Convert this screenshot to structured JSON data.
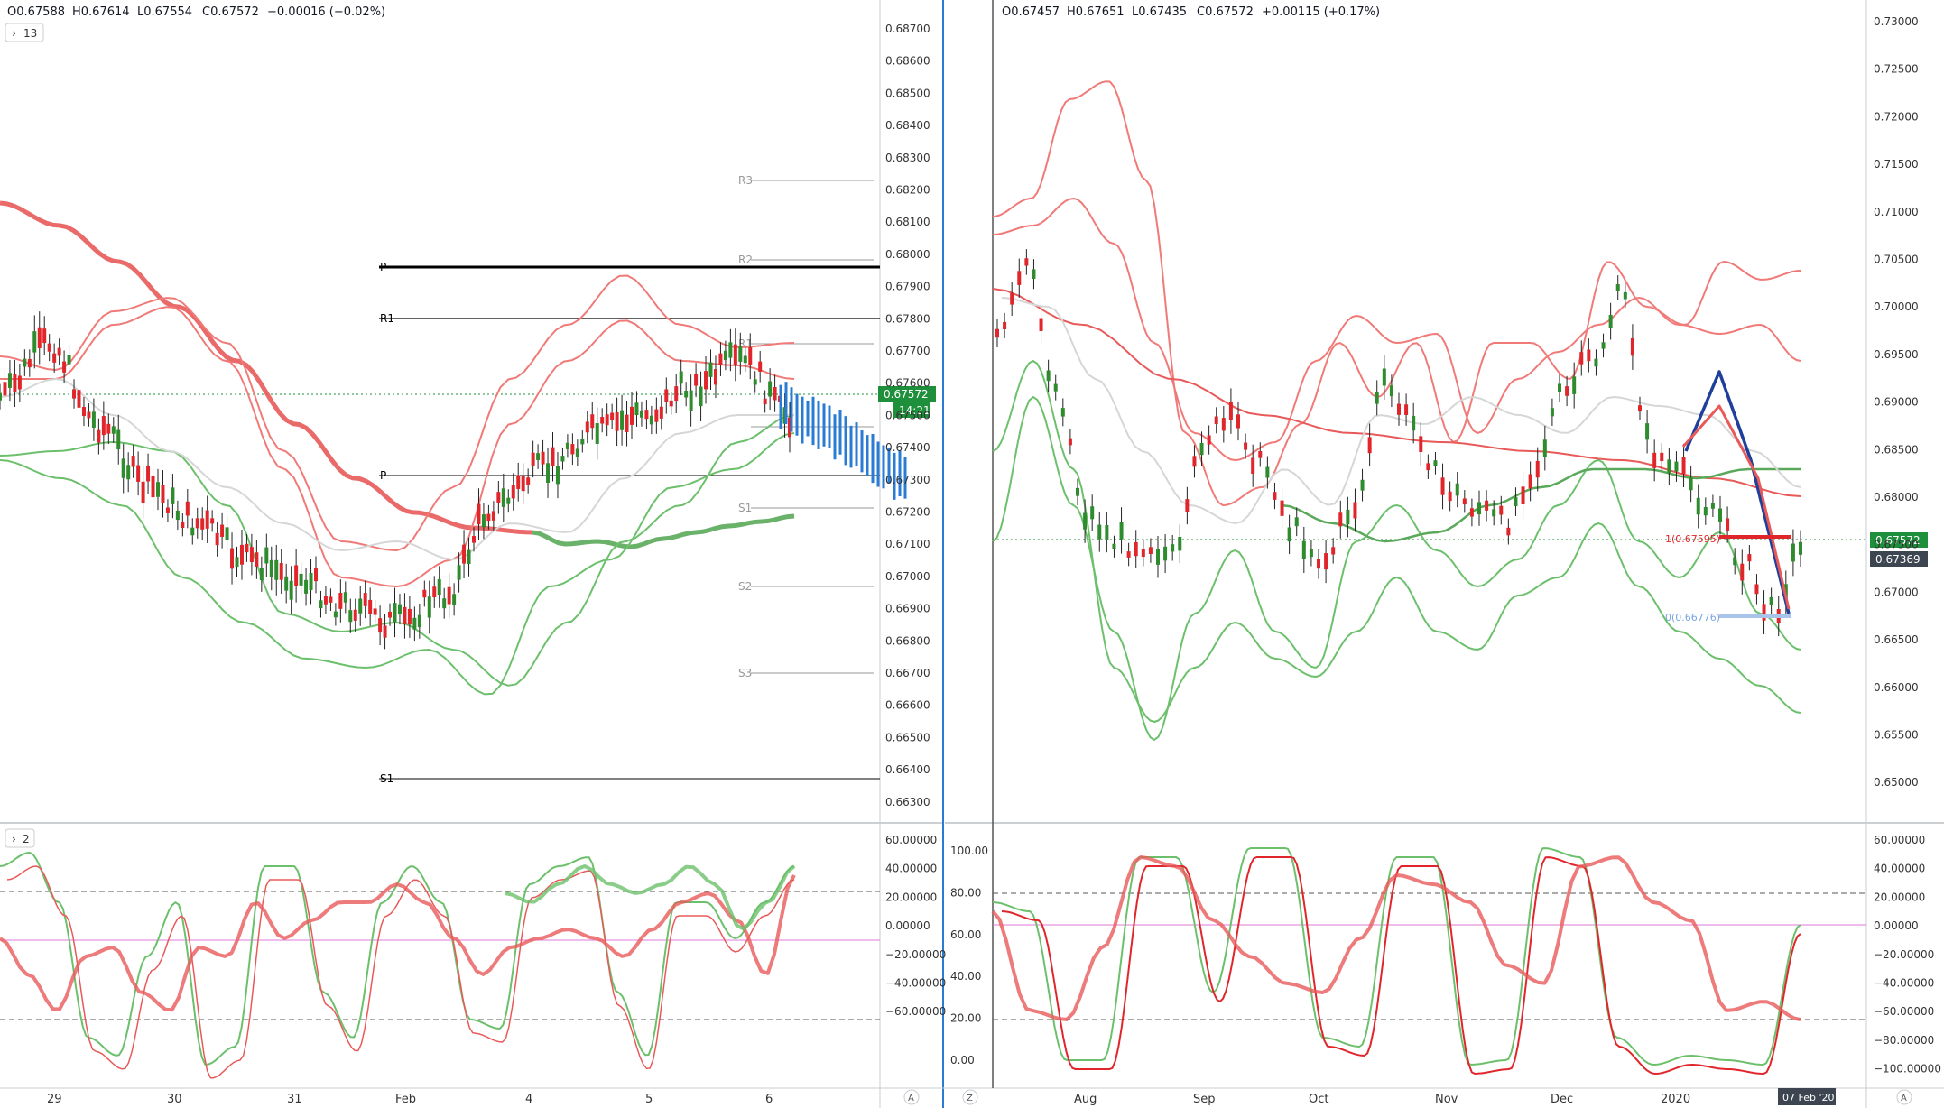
{
  "left_panel": {
    "ohlc": {
      "open": "O0.67588",
      "high": "H0.67614",
      "low": "L0.67554",
      "close": "C0.67572",
      "change": "−0.00016 (−0.02%)"
    },
    "interval_badge": "13",
    "price_scale": [
      "0.68700",
      "0.68600",
      "0.68500",
      "0.68400",
      "0.68300",
      "0.68200",
      "0.68100",
      "0.68000",
      "0.67900",
      "0.67800",
      "0.67700",
      "0.67600",
      "0.67500",
      "0.67400",
      "0.67300",
      "0.67200",
      "0.67100",
      "0.67000",
      "0.66900",
      "0.66800",
      "0.66700",
      "0.66600",
      "0.66500",
      "0.66400",
      "0.66300"
    ],
    "price_tag": "0.67572",
    "countdown": "14:21",
    "pivot_labels_bold": [
      "P",
      "R1",
      "P",
      "S1"
    ],
    "pivot_labels_light": [
      "R3",
      "R2",
      "R1",
      "S1",
      "S2",
      "S3"
    ],
    "osc_badge": "2",
    "osc_scale": [
      "60.00000",
      "40.00000",
      "20.00000",
      "0.00000",
      "−20.00000",
      "−40.00000",
      "−60.00000"
    ],
    "time_labels": [
      "29",
      "30",
      "31",
      "Feb",
      "4",
      "5",
      "6"
    ],
    "auto_btn": "A"
  },
  "right_panel": {
    "ohlc": {
      "open": "O0.67457",
      "high": "H0.67651",
      "low": "L0.67435",
      "close": "C0.67572",
      "change": "+0.00115 (+0.17%)"
    },
    "price_scale": [
      "0.73000",
      "0.72500",
      "0.72000",
      "0.71500",
      "0.71000",
      "0.70500",
      "0.70000",
      "0.69500",
      "0.69000",
      "0.68500",
      "0.68000",
      "0.67500",
      "0.67000",
      "0.66500",
      "0.66000",
      "0.65500",
      "0.65000"
    ],
    "price_tag_1": "0.67572",
    "price_tag_2": "0.67369",
    "fib_top": "1(0.67595)",
    "fib_bottom": "0(0.66776)",
    "osc_left_scale": [
      "100.00",
      "80.00",
      "60.00",
      "40.00",
      "20.00",
      "0.00"
    ],
    "osc_right_scale": [
      "60.00000",
      "40.00000",
      "20.00000",
      "0.00000",
      "−20.00000",
      "−40.00000",
      "−60.00000",
      "−80.00000",
      "−100.00000"
    ],
    "time_labels": [
      "Aug",
      "Sep",
      "Oct",
      "Nov",
      "Dec",
      "2020"
    ],
    "date_badge": "07 Feb '20",
    "zoom_btn": "Z",
    "auto_btn": "A"
  },
  "colors": {
    "up": "#2e8b2e",
    "down": "#e0262b",
    "band_red": "#f07a78",
    "band_green": "#6cc06c",
    "ma_red": "#e85a5a",
    "ma_green": "#5aa95a",
    "projection": "#2a7bd4",
    "fib_line": "#1f3f9a",
    "tag_green": "#1e8f3a",
    "tag_dark": "#3d4551"
  }
}
